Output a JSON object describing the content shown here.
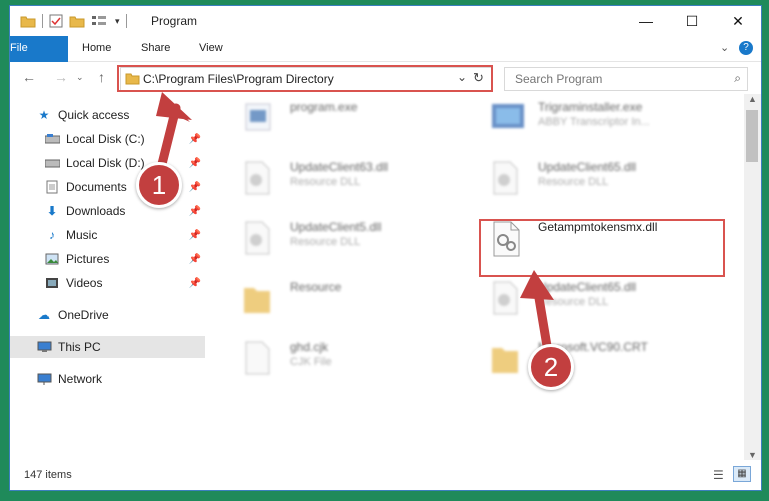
{
  "window": {
    "title": "Program"
  },
  "titlebar": {
    "icons": [
      "folder-icon",
      "properties-icon",
      "new-folder-icon",
      "customize-icon"
    ],
    "buttons": {
      "minimize": "—",
      "maximize": "☐",
      "close": "✕"
    }
  },
  "ribbon": {
    "tabs": [
      "File",
      "Home",
      "Share",
      "View"
    ],
    "help": "?"
  },
  "address": {
    "path": "C:\\Program Files\\Program Directory",
    "refresh": "↻"
  },
  "search": {
    "placeholder": "Search Program"
  },
  "sidebar": {
    "items": [
      {
        "label": "Quick access",
        "icon": "star-icon"
      },
      {
        "label": "Local Disk (C:)",
        "icon": "drive-icon",
        "pinned": true
      },
      {
        "label": "Local Disk (D:)",
        "icon": "drive-icon",
        "pinned": true
      },
      {
        "label": "Documents",
        "icon": "documents-icon",
        "pinned": true
      },
      {
        "label": "Downloads",
        "icon": "download-icon",
        "pinned": true
      },
      {
        "label": "Music",
        "icon": "music-icon",
        "pinned": true
      },
      {
        "label": "Pictures",
        "icon": "pictures-icon",
        "pinned": true
      },
      {
        "label": "Videos",
        "icon": "videos-icon",
        "pinned": true
      },
      {
        "label": "OneDrive",
        "icon": "cloud-icon"
      },
      {
        "label": "This PC",
        "icon": "computer-icon",
        "selected": true
      },
      {
        "label": "Network",
        "icon": "network-icon"
      }
    ]
  },
  "files": [
    {
      "name": "program.exe",
      "type": ""
    },
    {
      "name": "Trigraminstaller.exe",
      "type": "ABBY Transcriptor In..."
    },
    {
      "name": "UpdateClient63.dll",
      "type": "Resource DLL"
    },
    {
      "name": "UpdateClient65.dll",
      "type": "Resource DLL"
    },
    {
      "name": "UpdateClient5.dll",
      "type": "Resource DLL"
    },
    {
      "name": "Getampmtokensmx.dll",
      "type": ""
    },
    {
      "name": "Resource",
      "type": ""
    },
    {
      "name": "UpdateClient65.dll",
      "type": "Resource DLL"
    },
    {
      "name": "ghd.cjk",
      "type": "CJK File"
    },
    {
      "name": "Microsoft.VC90.CRT",
      "type": ""
    }
  ],
  "status": {
    "count": "147 items"
  },
  "annotations": {
    "badge1": "1",
    "badge2": "2"
  },
  "colors": {
    "accent": "#1979ca",
    "highlight": "#d9534f",
    "badge": "#c23f3f"
  }
}
